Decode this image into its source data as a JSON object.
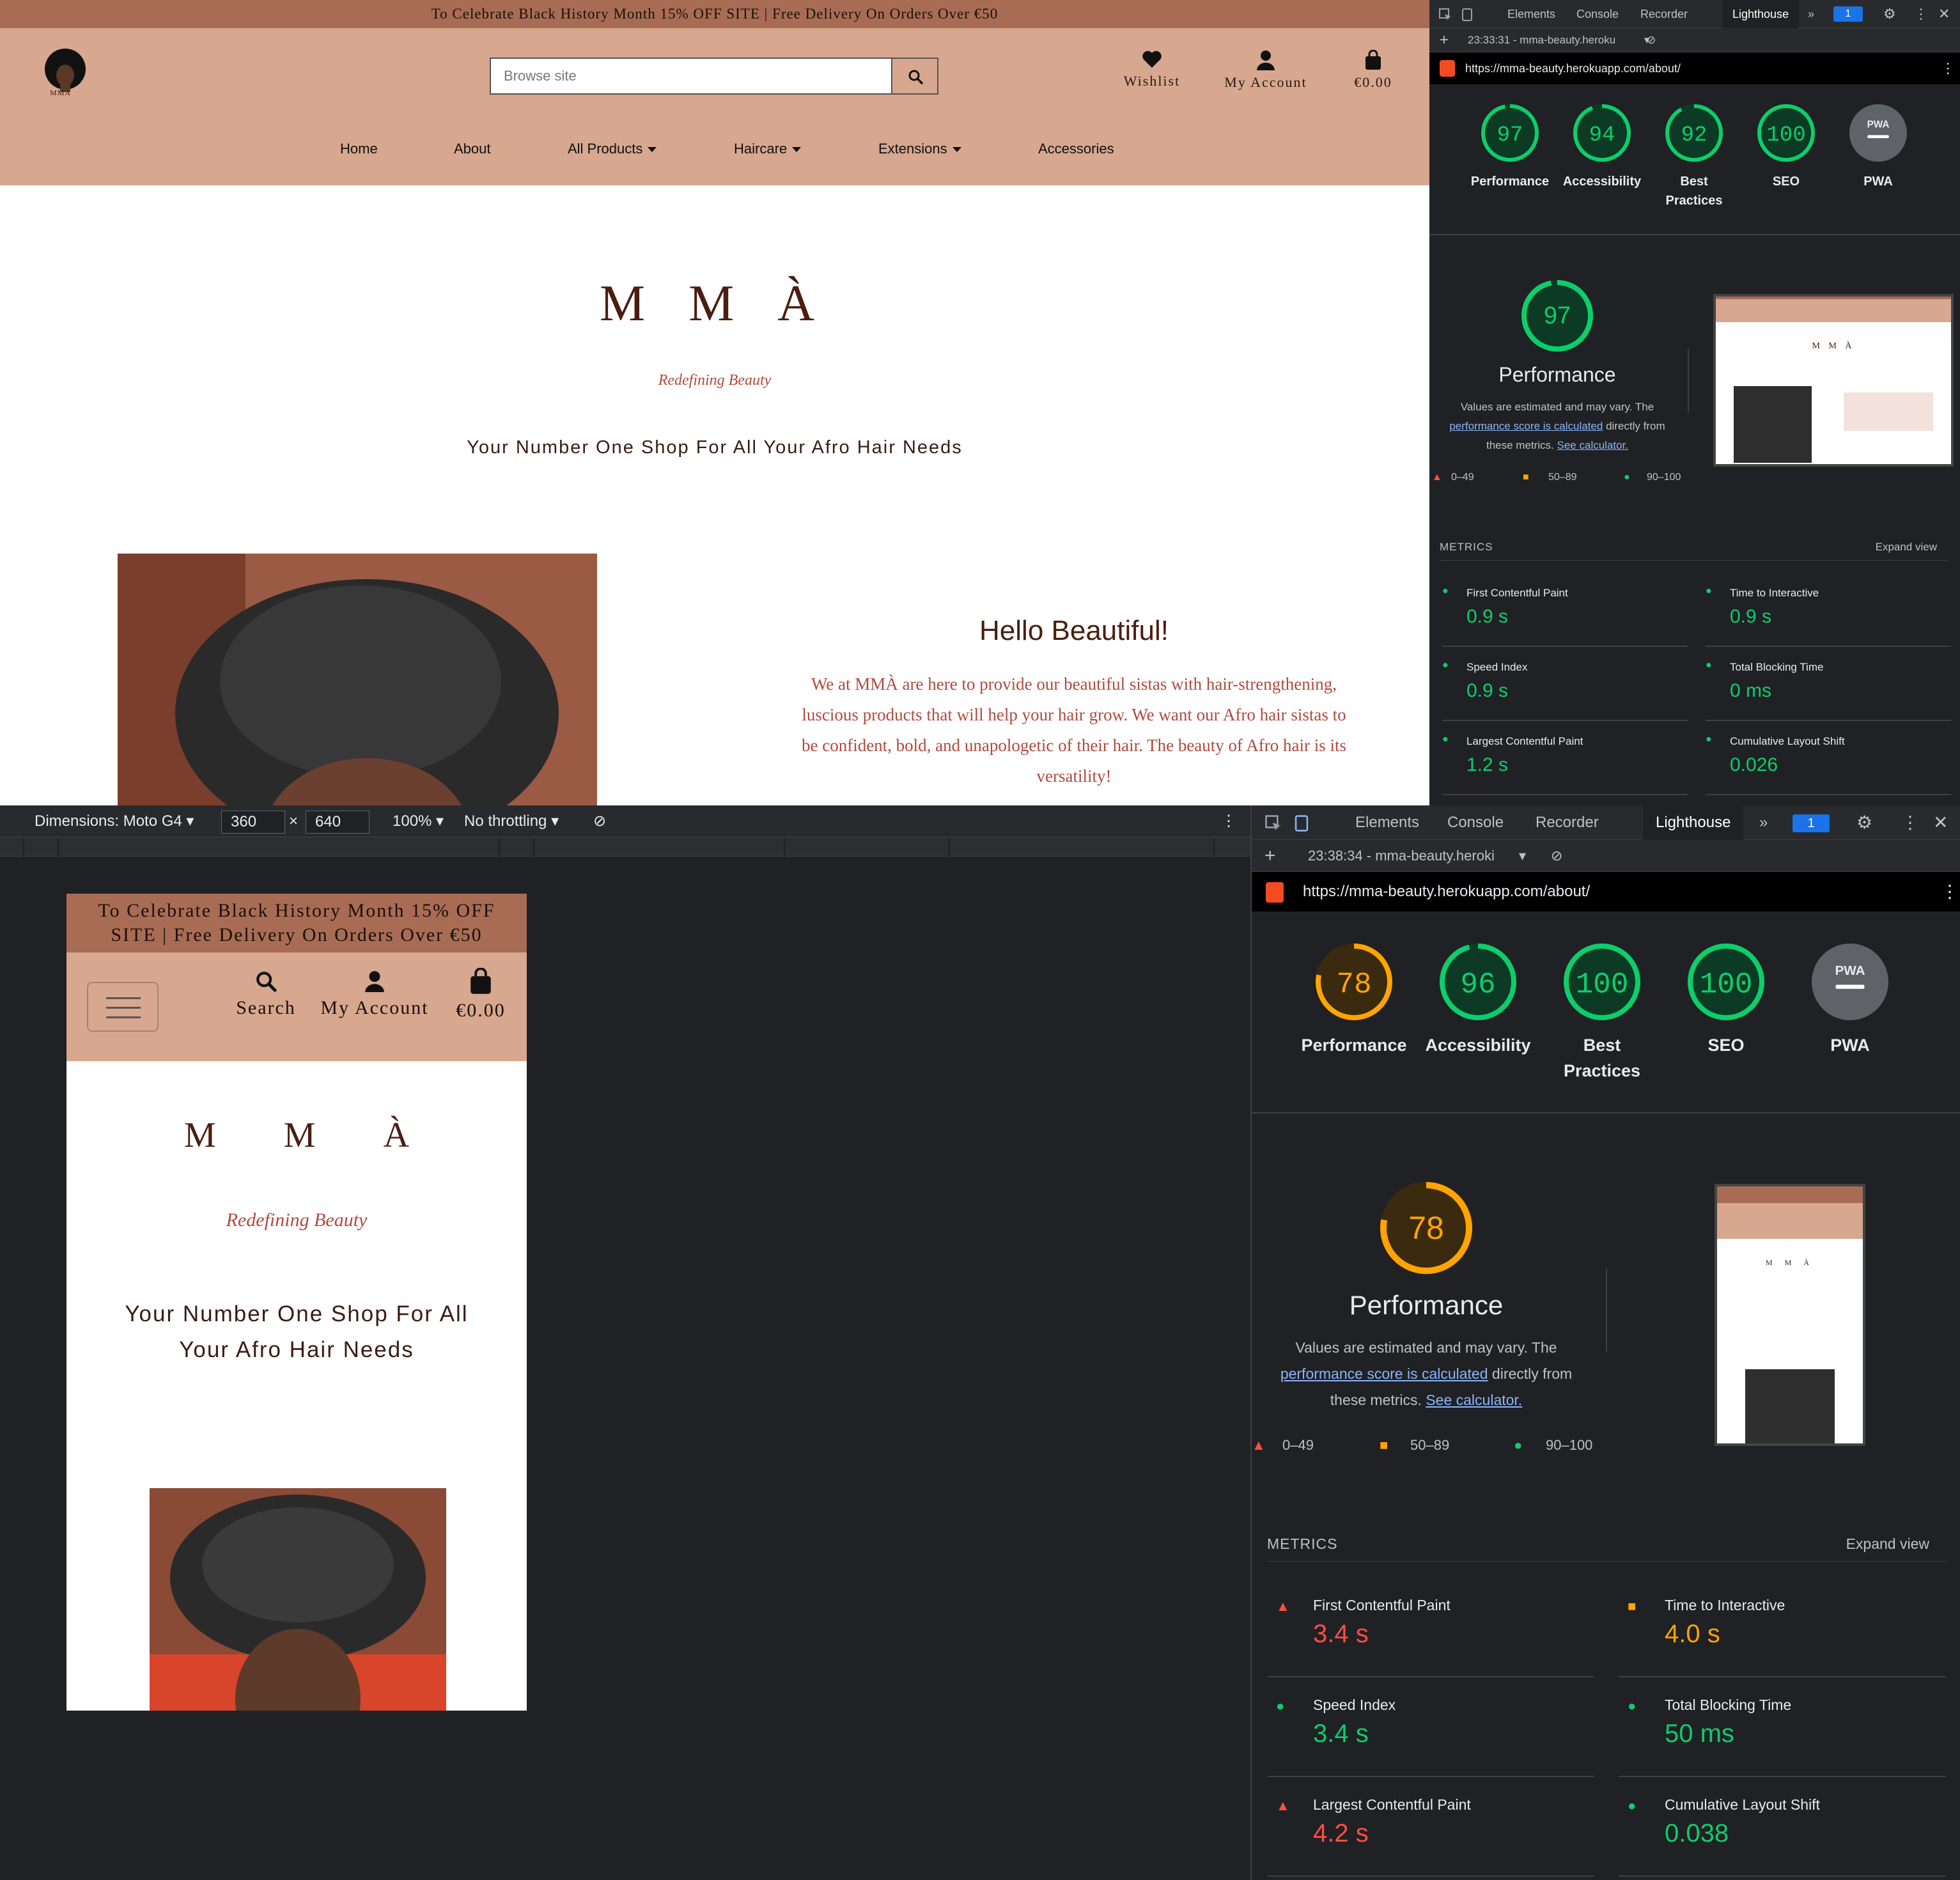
{
  "site": {
    "promo": "To Celebrate Black History Month 15% OFF SITE | Free Delivery On Orders Over €50",
    "logo_text": "MMA",
    "search_placeholder": "Browse site",
    "wishlist": "Wishlist",
    "account": "My Account",
    "bag": "€0.00",
    "search_label": "Search",
    "nav": [
      "Home",
      "About",
      "All Products",
      "Haircare",
      "Extensions",
      "Accessories"
    ],
    "brand": "M M À",
    "tagline": "Redefining Beauty",
    "subline": "Your Number One Shop For All Your Afro Hair Needs",
    "hello_title": "Hello Beautiful!",
    "hello_body": "We at MMÀ are here to provide our beautiful sistas with hair-strengthening, luscious products that will help your hair grow. We want our Afro hair sistas to be confident, bold, and unapologetic of their hair. The beauty of Afro hair is its versatility!"
  },
  "devtools_top": {
    "tabs": [
      "Elements",
      "Console",
      "Recorder",
      "Lighthouse"
    ],
    "badge": "1",
    "report": "23:33:31 - mma-beauty.heroku",
    "url": "https://mma-beauty.herokuapp.com/about/",
    "scores": [
      {
        "label": "Performance",
        "value": 97,
        "color": "#0cce6b"
      },
      {
        "label": "Accessibility",
        "value": 94,
        "color": "#0cce6b"
      },
      {
        "label": "Best Practices",
        "value": 92,
        "color": "#0cce6b"
      },
      {
        "label": "SEO",
        "value": 100,
        "color": "#0cce6b"
      },
      {
        "label": "PWA",
        "value": "PWA",
        "color": "#9aa0a6"
      }
    ],
    "perf_score": 97,
    "perf_title": "Performance",
    "perf_note_1": "Values are estimated and may vary. The",
    "perf_link_1": "performance score is calculated",
    "perf_note_2": "directly from",
    "perf_note_3": "these metrics.",
    "perf_link_2": "See calculator.",
    "legend": [
      "0–49",
      "50–89",
      "90–100"
    ],
    "metrics_title": "METRICS",
    "expand": "Expand view",
    "metrics": [
      {
        "name": "First Contentful Paint",
        "value": "0.9 s",
        "status": "good"
      },
      {
        "name": "Time to Interactive",
        "value": "0.9 s",
        "status": "good"
      },
      {
        "name": "Speed Index",
        "value": "0.9 s",
        "status": "good"
      },
      {
        "name": "Total Blocking Time",
        "value": "0 ms",
        "status": "good"
      },
      {
        "name": "Largest Contentful Paint",
        "value": "1.2 s",
        "status": "good"
      },
      {
        "name": "Cumulative Layout Shift",
        "value": "0.026",
        "status": "good"
      }
    ]
  },
  "emulator": {
    "dimensions_label": "Dimensions: Moto G4",
    "width": "360",
    "height": "640",
    "zoom": "100%",
    "throttle": "No throttling"
  },
  "devtools_bottom": {
    "tabs": [
      "Elements",
      "Console",
      "Recorder",
      "Lighthouse"
    ],
    "badge": "1",
    "report": "23:38:34 - mma-beauty.heroki",
    "url": "https://mma-beauty.herokuapp.com/about/",
    "scores": [
      {
        "label": "Performance",
        "value": 78,
        "color": "#ffa400"
      },
      {
        "label": "Accessibility",
        "value": 96,
        "color": "#0cce6b"
      },
      {
        "label": "Best Practices",
        "value": 100,
        "color": "#0cce6b"
      },
      {
        "label": "SEO",
        "value": 100,
        "color": "#0cce6b"
      },
      {
        "label": "PWA",
        "value": "PWA",
        "color": "#9aa0a6"
      }
    ],
    "perf_score": 78,
    "perf_title": "Performance",
    "perf_note_1": "Values are estimated and may vary. The",
    "perf_link_1": "performance score is calculated",
    "perf_note_2": "directly from",
    "perf_note_3": "these metrics.",
    "perf_link_2": "See calculator.",
    "legend": [
      "0–49",
      "50–89",
      "90–100"
    ],
    "metrics_title": "METRICS",
    "expand": "Expand view",
    "metrics": [
      {
        "name": "First Contentful Paint",
        "value": "3.4 s",
        "status": "bad"
      },
      {
        "name": "Time to Interactive",
        "value": "4.0 s",
        "status": "average"
      },
      {
        "name": "Speed Index",
        "value": "3.4 s",
        "status": "good"
      },
      {
        "name": "Total Blocking Time",
        "value": "50 ms",
        "status": "good"
      },
      {
        "name": "Largest Contentful Paint",
        "value": "4.2 s",
        "status": "bad"
      },
      {
        "name": "Cumulative Layout Shift",
        "value": "0.038",
        "status": "good"
      }
    ]
  },
  "colors": {
    "good": "#0cce6b",
    "average": "#ffa400",
    "bad": "#ff4e42",
    "brand": "#d7a78f",
    "promo": "#a86c55"
  }
}
